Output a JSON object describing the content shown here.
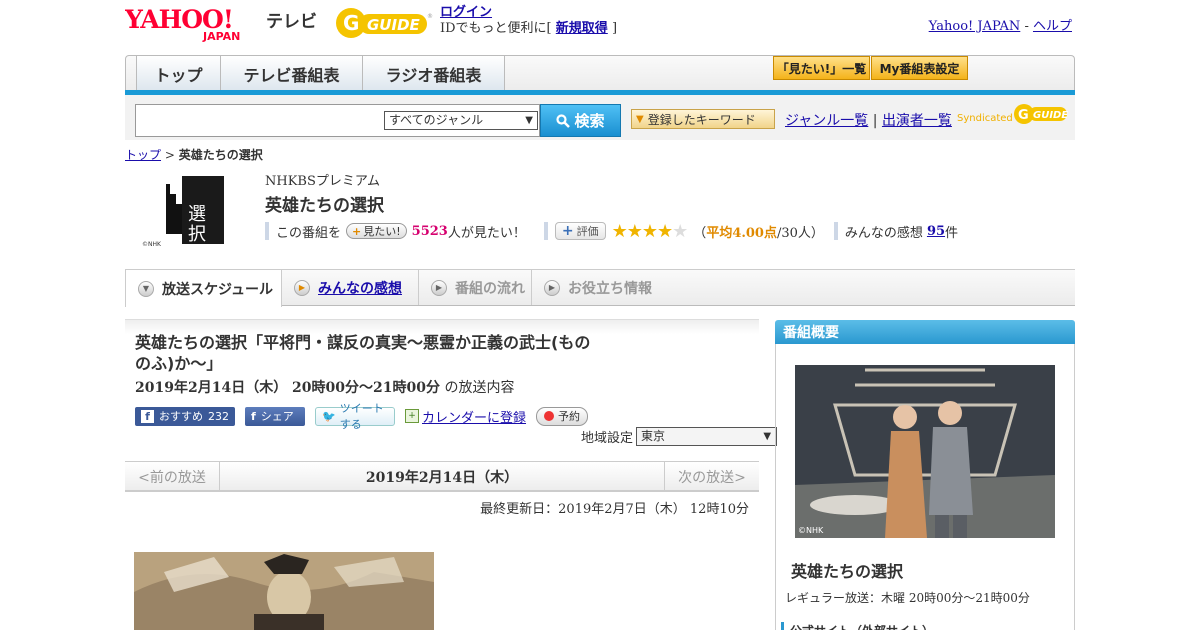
{
  "header": {
    "yahoo_logo": "YAHOO! JAPAN",
    "tv_label": "テレビ",
    "gguide_logo": "GUIDE",
    "login": "ログイン",
    "login_sub": "IDでもっと便利に[",
    "signup": "新規取得",
    "signup_close": "]",
    "yahoo_japan": "Yahoo! JAPAN",
    "dash": "-",
    "help": "ヘルプ"
  },
  "nav": {
    "tabs": [
      "トップ",
      "テレビ番組表",
      "ラジオ番組表"
    ],
    "mitai_list": "「見たい!」一覧",
    "my_settings": "My番組表設定"
  },
  "search": {
    "query": "",
    "genre": "すべてのジャンル",
    "button": "検索",
    "keyword_button": "登録したキーワード",
    "genre_list": "ジャンル一覧",
    "separator": "|",
    "performer_list": "出演者一覧",
    "syndicated": "Syndicated"
  },
  "breadcrumb": {
    "top": "トップ",
    "sep": ">",
    "current": "英雄たちの選択"
  },
  "program": {
    "channel": "NHKBSプレミアム",
    "title": "英雄たちの選択",
    "thumb_credit": "©NHK",
    "mitai_prefix": "この番組を",
    "mitai_button": "見たい!",
    "mitai_count": "5523",
    "mitai_suffix": "人が見たい！",
    "hyoka_button": "評価",
    "rating_stars": 4,
    "rating_open": "（",
    "rating_avg": "平均4.00点",
    "rating_count": "/30人）",
    "kansou_label": "みんなの感想",
    "kansou_count": "95",
    "kansou_unit": "件"
  },
  "subtabs": [
    {
      "label": "放送スケジュール",
      "active": true
    },
    {
      "label": "みんなの感想",
      "link": true
    },
    {
      "label": "番組の流れ"
    },
    {
      "label": "お役立ち情報"
    }
  ],
  "episode": {
    "title": "英雄たちの選択「平将門・謀反の真実～悪霊か正義の武士(もののふ)か～」",
    "date": "2019年2月14日（木） 20時00分～21時00分",
    "date_suffix": "の放送内容",
    "fb_recommend": "おすすめ",
    "fb_count": "232",
    "fb_share": "シェア",
    "tweet": "ツイートする",
    "calendar": "カレンダーに登録",
    "reserve": "予約",
    "region_label": "地域設定",
    "region_value": "東京",
    "prev": "<前の放送",
    "current_date": "2019年2月14日（木）",
    "next": "次の放送>",
    "updated": "最終更新日：2019年2月7日（木） 12時10分"
  },
  "right_panel": {
    "heading": "番組概要",
    "photo_credit": "©NHK",
    "title": "英雄たちの選択",
    "regular": "レギュラー放送：木曜 20時00分～21時00分",
    "official_site": "公式サイト（外部サイト）"
  },
  "colors": {
    "accent_blue": "#1a9ad6",
    "link": "#1a0dab",
    "pink": "#d6006f",
    "orange": "#e08a00",
    "star": "#f0b400"
  }
}
